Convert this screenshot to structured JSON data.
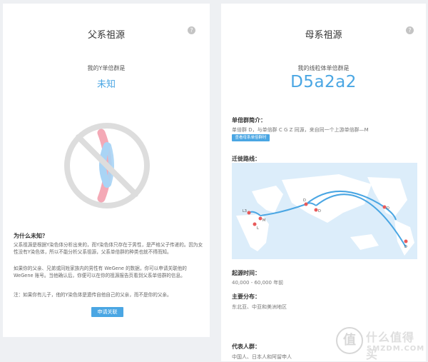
{
  "left": {
    "title": "父系祖源",
    "help_icon": "?",
    "haplogroup_label": "我的Y单倍群是",
    "haplogroup_value": "未知",
    "why_title": "为什么未知？",
    "paragraphs": [
      "父系祖源是根据Y染色体分析出来的，而Y染色体只存在于男性，是严格父子传递的。因为女性没有Y染色体，所以不能分析父系祖源，父系单倍群的种类也就不得而知。",
      "如果你的父亲、兄弟或同姓家族内的男性有 WeGene 的数据，你可以申请关联他的 WeGene 账号。当他确认后，你便可以在你的祖源报告页看到父系单倍群的信息。",
      "注：如果你有儿子，他的Y染色体是遗传自他自己的父亲，而不是你的父亲。"
    ],
    "request_button": "申请关联",
    "colors": {
      "accent": "#4aa6e3",
      "chrom_pink": "#f4a9b6",
      "chrom_blue": "#a9d4f5",
      "prohibit": "#dddddd"
    }
  },
  "right": {
    "title": "母系祖源",
    "help_icon": "?",
    "haplogroup_label": "我的线粒体单倍群是",
    "haplogroup_value": "D5a2a2",
    "intro_title": "单倍群简介：",
    "intro_text": "单倍群 D，与单倍群 C G Z 同源，来自同一个上游单倍群—M",
    "detail_button": "查看母系单倍群时",
    "route_title": "迁徙路线：",
    "map_points": [
      "L3",
      "L",
      "M",
      "D",
      "D",
      "D",
      "D"
    ],
    "origin_title": "起源时间：",
    "origin_text": "40,000 - 60,000 年前",
    "distribution_title": "主要分布：",
    "distribution_text": "东北亚、中亚和美洲地区",
    "population_title": "代表人群：",
    "population_text": "中国人、日本人和阿留申人",
    "colors": {
      "map_bg": "#dcedfa",
      "land": "#ffffff",
      "route": "#4aa6e3",
      "point": "#e85a5a"
    }
  },
  "watermark": {
    "logo": "值",
    "main": "什么值得买",
    "sub": "SMZDM.COM"
  }
}
